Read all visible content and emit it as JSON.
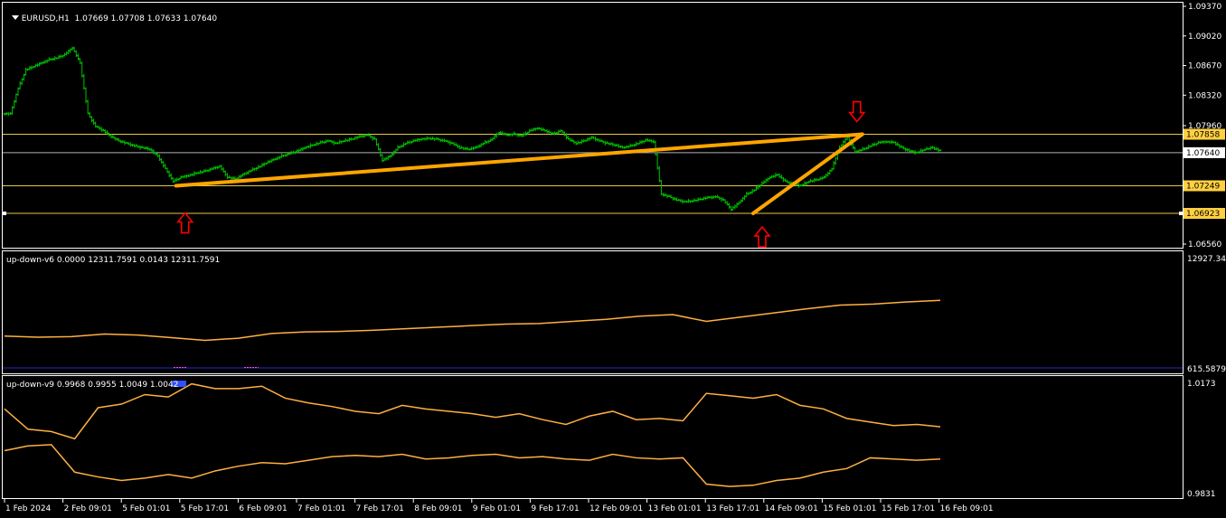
{
  "colors": {
    "background": "#000000",
    "grid_frame": "#ffffff",
    "candle": "#00c000",
    "trendline": "#ffa500",
    "hline": "#e6c84a",
    "marker_arrow": "#ff0000",
    "indicator_line": "#ffb040",
    "label_bg": "#ffd040"
  },
  "main": {
    "symbol": "EURUSD,H1",
    "ohlc": "1.07669 1.07708 1.07633 1.07640",
    "collapse_icon": "triangle-down-icon"
  },
  "indicator1": {
    "title": "up-down-v6 0.0000 12311.7591 0.0143 12311.7591",
    "axis_top": "12927.347",
    "axis_bottom": "615.5879"
  },
  "indicator2": {
    "title": "up-down-v9 0.9968 0.9955 1.0049 1.0042",
    "axis_top": "1.0173",
    "axis_bottom": "0.9831"
  },
  "chart_data": [
    {
      "type": "candlestick",
      "title": "EURUSD,H1",
      "y_ticks": [
        "1.09370",
        "1.09020",
        "1.08670",
        "1.08320",
        "1.07960",
        "1.07640",
        "1.06560"
      ],
      "ylim": [
        1.0656,
        1.0937
      ],
      "price_labels": [
        {
          "text": "1.07858",
          "value": 1.07858,
          "highlight": true
        },
        {
          "text": "1.07640",
          "value": 1.0764,
          "highlight": false
        },
        {
          "text": "1.07249",
          "value": 1.07249,
          "highlight": true
        },
        {
          "text": "1.06923",
          "value": 1.06923,
          "highlight": true
        }
      ],
      "horizontal_lines": [
        1.07858,
        1.0764,
        1.07249,
        1.06923
      ],
      "x_labels": [
        "1 Feb 2024",
        "2 Feb 09:01",
        "5 Feb 01:01",
        "5 Feb 17:01",
        "6 Feb 09:01",
        "7 Feb 01:01",
        "7 Feb 17:01",
        "8 Feb 09:01",
        "9 Feb 01:01",
        "9 Feb 17:01",
        "12 Feb 09:01",
        "13 Feb 01:01",
        "13 Feb 17:01",
        "14 Feb 09:01",
        "15 Feb 01:01",
        "15 Feb 17:01",
        "16 Feb 09:01"
      ],
      "close_series": [
        1.081,
        1.084,
        1.0862,
        1.0866,
        1.087,
        1.0874,
        1.0876,
        1.088,
        1.0888,
        1.087,
        1.081,
        1.0795,
        1.079,
        1.0783,
        1.0778,
        1.0775,
        1.0772,
        1.077,
        1.0768,
        1.076,
        1.0745,
        1.073,
        1.0735,
        1.0737,
        1.074,
        1.0742,
        1.0745,
        1.0748,
        1.0735,
        1.0733,
        1.0738,
        1.0743,
        1.0747,
        1.0752,
        1.0756,
        1.076,
        1.0763,
        1.0766,
        1.077,
        1.0773,
        1.0776,
        1.0778,
        1.0775,
        1.0778,
        1.078,
        1.0783,
        1.0785,
        1.078,
        1.0755,
        1.076,
        1.077,
        1.0775,
        1.0778,
        1.078,
        1.0781,
        1.078,
        1.0778,
        1.0775,
        1.077,
        1.0768,
        1.077,
        1.0775,
        1.0779,
        1.0788,
        1.0785,
        1.0786,
        1.0784,
        1.079,
        1.0793,
        1.079,
        1.0786,
        1.079,
        1.078,
        1.0775,
        1.0778,
        1.0782,
        1.0778,
        1.0775,
        1.0773,
        1.077,
        1.0772,
        1.0775,
        1.0779,
        1.0777,
        1.0715,
        1.0712,
        1.0708,
        1.0706,
        1.0707,
        1.0709,
        1.0711,
        1.0712,
        1.0708,
        1.0697,
        1.0705,
        1.0715,
        1.072,
        1.0728,
        1.0735,
        1.0738,
        1.073,
        1.0727,
        1.0725,
        1.073,
        1.0732,
        1.0735,
        1.0745,
        1.077,
        1.0783,
        1.0765,
        1.0768,
        1.0772,
        1.0776,
        1.0777,
        1.0776,
        1.077,
        1.0766,
        1.0764,
        1.0768,
        1.077,
        1.0766
      ],
      "trendlines": [
        {
          "from": [
            0,
            1.07249
          ],
          "to": [
            1,
            1.07858
          ]
        },
        {
          "from": [
            0,
            1.06923
          ],
          "to": [
            1,
            1.07858
          ]
        }
      ],
      "markers": [
        {
          "kind": "arrow-up",
          "series_index": 22
        },
        {
          "kind": "arrow-down",
          "series_index": 110
        },
        {
          "kind": "arrow-up",
          "series_index": 96
        }
      ]
    },
    {
      "type": "line",
      "title": "up-down-v6",
      "ylim": [
        615.5879,
        12927.347
      ],
      "series": [
        {
          "values": [
            0.26,
            0.25,
            0.255,
            0.28,
            0.27,
            0.245,
            0.22,
            0.24,
            0.285,
            0.3,
            0.305,
            0.315,
            0.33,
            0.345,
            0.36,
            0.375,
            0.38,
            0.4,
            0.42,
            0.45,
            0.465,
            0.4,
            0.44,
            0.48,
            0.52,
            0.555,
            0.565,
            0.585,
            0.6
          ]
        }
      ]
    },
    {
      "type": "line",
      "title": "up-down-v9",
      "ylim": [
        0.9831,
        1.0173
      ],
      "series": [
        {
          "values": [
            0.74,
            0.57,
            0.55,
            0.49,
            0.75,
            0.78,
            0.86,
            0.84,
            0.95,
            0.91,
            0.91,
            0.93,
            0.83,
            0.79,
            0.76,
            0.72,
            0.7,
            0.77,
            0.74,
            0.72,
            0.7,
            0.67,
            0.7,
            0.65,
            0.61,
            0.68,
            0.72,
            0.65,
            0.66,
            0.64,
            0.87,
            0.85,
            0.83,
            0.86,
            0.77,
            0.74,
            0.66,
            0.63,
            0.6,
            0.61,
            0.59
          ]
        },
        {
          "values": [
            0.39,
            0.43,
            0.44,
            0.21,
            0.17,
            0.14,
            0.16,
            0.19,
            0.16,
            0.22,
            0.26,
            0.29,
            0.28,
            0.31,
            0.34,
            0.35,
            0.34,
            0.36,
            0.32,
            0.33,
            0.35,
            0.36,
            0.33,
            0.34,
            0.32,
            0.31,
            0.36,
            0.33,
            0.32,
            0.33,
            0.11,
            0.09,
            0.1,
            0.14,
            0.16,
            0.21,
            0.24,
            0.33,
            0.32,
            0.31,
            0.32
          ]
        }
      ]
    }
  ]
}
